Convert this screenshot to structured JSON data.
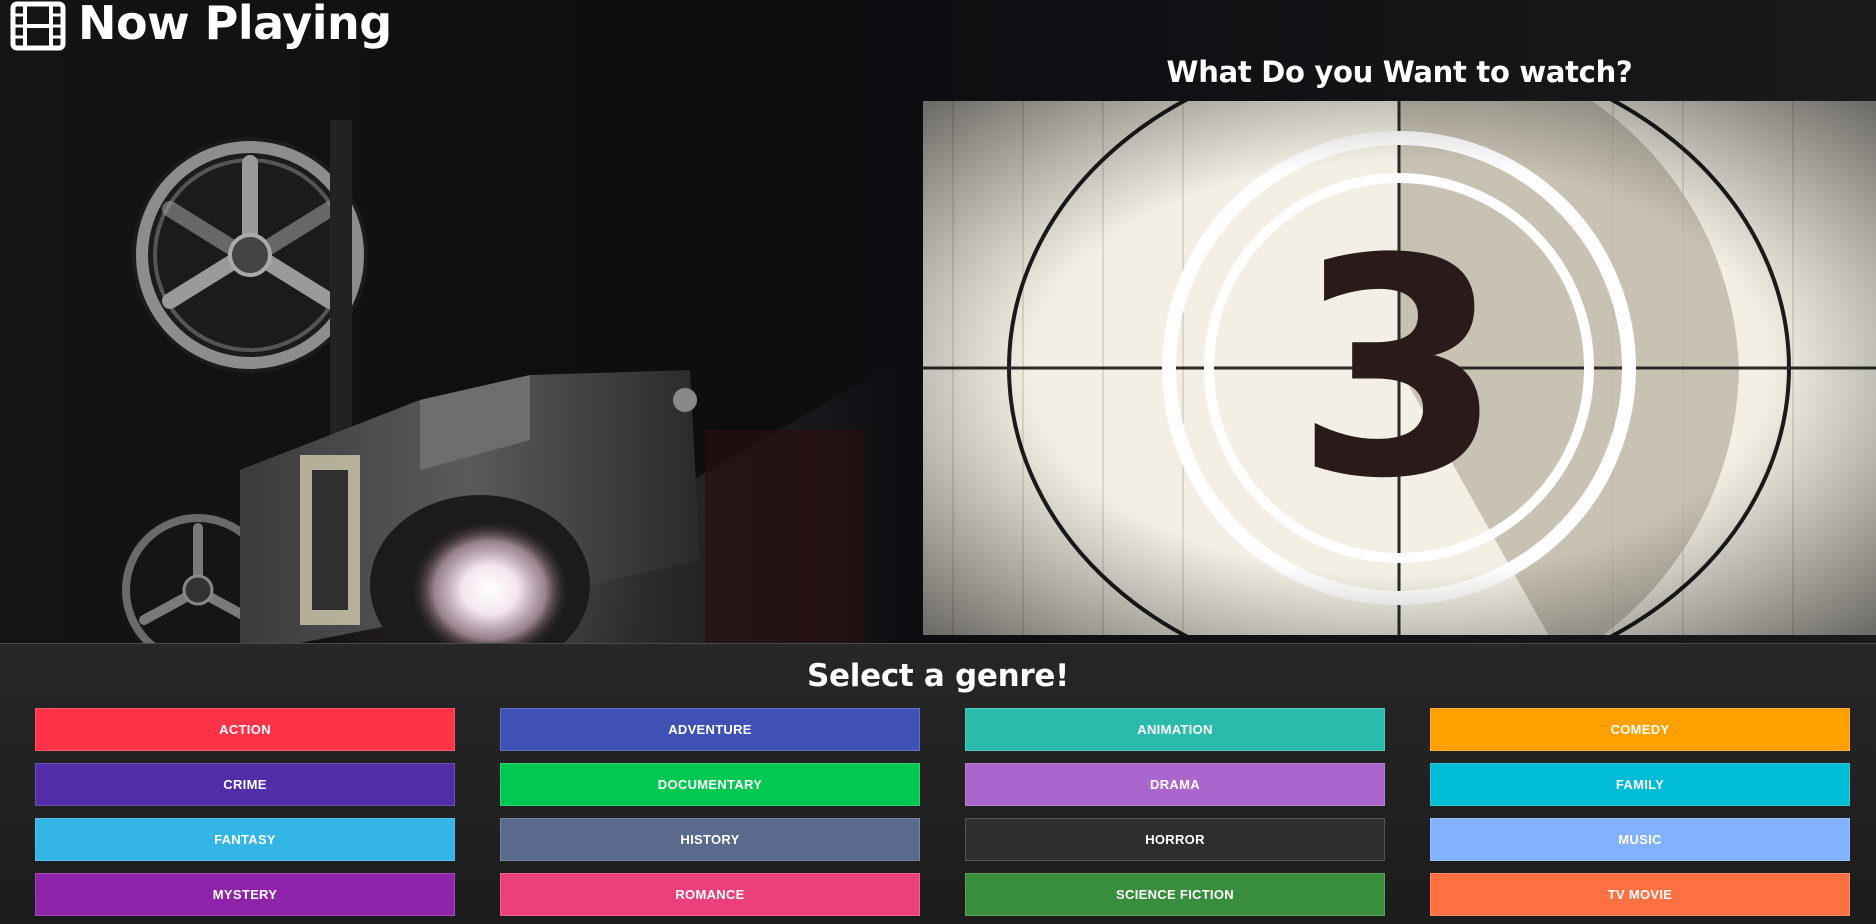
{
  "app": {
    "title": "Now Playing",
    "logo_icon": "film-icon"
  },
  "hero": {
    "prompt": "What Do you Want to watch?",
    "countdown_number": "3"
  },
  "genres": {
    "title": "Select a genre!",
    "items": [
      {
        "label": "ACTION",
        "color": "#ff3347"
      },
      {
        "label": "ADVENTURE",
        "color": "#3f51b5"
      },
      {
        "label": "ANIMATION",
        "color": "#2bbbad"
      },
      {
        "label": "COMEDY",
        "color": "#ff9f00"
      },
      {
        "label": "CRIME",
        "color": "#512da8"
      },
      {
        "label": "DOCUMENTARY",
        "color": "#00c851"
      },
      {
        "label": "DRAMA",
        "color": "#aa66cc"
      },
      {
        "label": "FAMILY",
        "color": "#00bcd4"
      },
      {
        "label": "FANTASY",
        "color": "#33b5e5"
      },
      {
        "label": "HISTORY",
        "color": "#5a6a8c"
      },
      {
        "label": "HORROR",
        "color": "#2e2e2e"
      },
      {
        "label": "MUSIC",
        "color": "#82b1ff"
      },
      {
        "label": "MYSTERY",
        "color": "#8e24aa"
      },
      {
        "label": "ROMANCE",
        "color": "#ec407a"
      },
      {
        "label": "SCIENCE FICTION",
        "color": "#388e3c"
      },
      {
        "label": "TV MOVIE",
        "color": "#ff7043"
      }
    ]
  }
}
